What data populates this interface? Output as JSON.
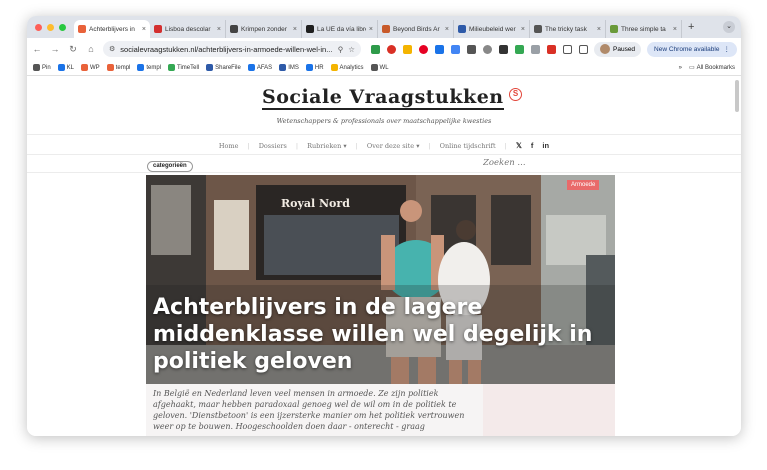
{
  "browser": {
    "tabs": [
      {
        "title": "Achterblijvers in",
        "color": "#e9623a",
        "active": true
      },
      {
        "title": "Lisboa descolar",
        "color": "#d32f2f"
      },
      {
        "title": "Krimpen zonder",
        "color": "#444444"
      },
      {
        "title": "La UE da vía libre",
        "color": "#1f1f1f"
      },
      {
        "title": "Beyond Birds Ar",
        "color": "#c85a2a"
      },
      {
        "title": "Milieubeleid wer",
        "color": "#2e5aa8"
      },
      {
        "title": "The tricky task",
        "color": "#555555"
      },
      {
        "title": "Three simple ta",
        "color": "#6a9a3a"
      }
    ],
    "tab_close": "×",
    "new_tab": "+",
    "tab_menu": "⌄",
    "address": "socialevraagstukken.nl/achterblijvers-in-armoede-willen-wel-in...",
    "paused_label": "Paused",
    "update_label": "New Chrome available",
    "bookmarks": [
      "Pin",
      "KL",
      "WP",
      "templ",
      "templ",
      "TimeTell",
      "ShareFile",
      "AFAS",
      "IMS",
      "HR",
      "Analytics",
      "WL"
    ],
    "all_bookmarks": "All Bookmarks"
  },
  "site": {
    "logo": "Sociale Vraagstukken",
    "logo_mark": "S",
    "tagline": "Wetenschappers & professionals over maatschappelijke kwesties",
    "nav": [
      "Home",
      "Dossiers",
      "Rubrieken",
      "Over deze site",
      "Online tijdschrift"
    ],
    "category_button": "categorieën",
    "search_placeholder": "Zoeken ...",
    "social": [
      "twitter-icon",
      "facebook-icon",
      "linkedin-icon"
    ]
  },
  "article": {
    "tag": "Armoede",
    "headline": "Achterblijvers in de lagere middenklasse willen wel degelijk in politiek geloven",
    "shop_sign": "Royal Nord",
    "lead": "In België en Nederland leven veel mensen in armoede. Ze zijn politiek afgehaakt, maar hebben paradoxaal genoeg wel de wil om in de politiek te geloven. 'Dienstbetoon' is een ijzersterke manier om het politiek vertrouwen weer op te bouwen. Hoogeschoolden doen daar - onterecht - graag"
  }
}
